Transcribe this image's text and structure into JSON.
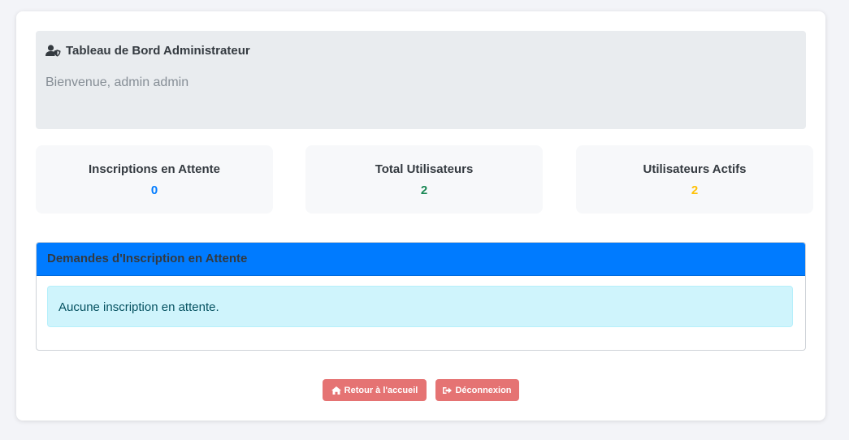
{
  "dashboard": {
    "title": "Tableau de Bord Administrateur",
    "title_icon": "user-shield-icon",
    "welcome": "Bienvenue, admin admin"
  },
  "stats": [
    {
      "label": "Inscriptions en Attente",
      "value": "0",
      "color": "#007bff"
    },
    {
      "label": "Total Utilisateurs",
      "value": "2",
      "color": "#198754"
    },
    {
      "label": "Utilisateurs Actifs",
      "value": "2",
      "color": "#ffc107"
    }
  ],
  "pending_panel": {
    "header": "Demandes d'Inscription en Attente",
    "header_color": "#007bff",
    "empty_message": "Aucune inscription en attente."
  },
  "actions": {
    "home_label": "Retour à l'accueil",
    "home_icon": "home-icon",
    "logout_label": "Déconnexion",
    "logout_icon": "sign-out-icon",
    "button_color": "#e57373"
  }
}
